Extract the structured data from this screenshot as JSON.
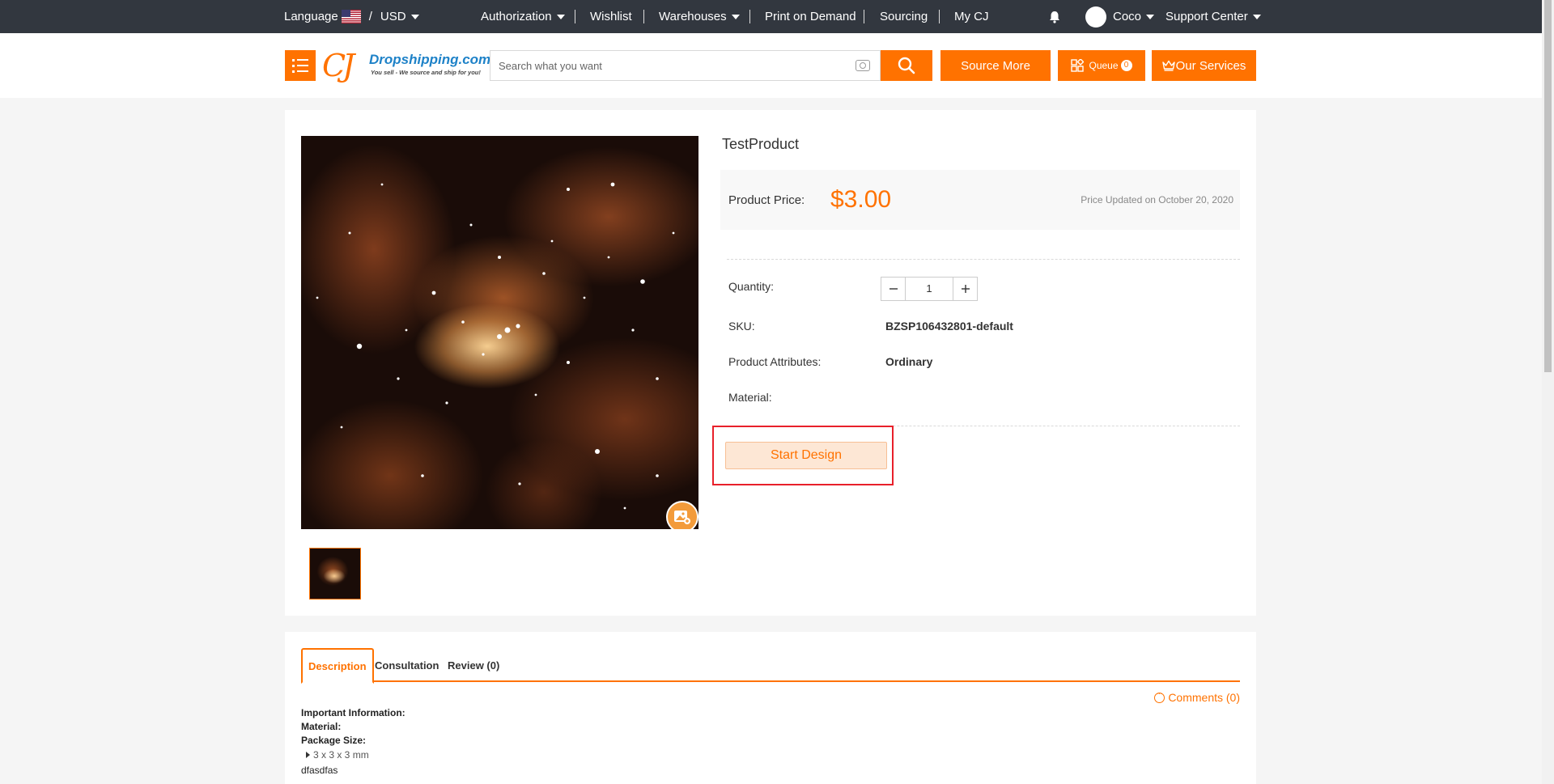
{
  "topbar": {
    "language_label": "Language",
    "slash": "/",
    "currency": "USD",
    "nav": {
      "authorization": "Authorization",
      "wishlist": "Wishlist",
      "warehouses": "Warehouses",
      "print_on_demand": "Print on Demand",
      "sourcing": "Sourcing",
      "my_cj": "My CJ"
    },
    "user_name": "Coco",
    "support": "Support Center",
    "icons": [
      "us-flag-icon",
      "bell-icon",
      "avatar",
      "caret-down-icon"
    ]
  },
  "header": {
    "logo": {
      "mark": "CJ",
      "brand": "Dropshipping.com",
      "tagline": "You sell - We source and ship for you!"
    },
    "search_placeholder": "Search what you want",
    "source_more": "Source More",
    "queue_label": "Queue",
    "queue_count": "0",
    "our_services": "Our Services",
    "icons": [
      "menu-icon",
      "camera-icon",
      "search-icon",
      "queue-icon",
      "crown-icon"
    ],
    "accent": "#ff7200"
  },
  "product": {
    "title": "TestProduct",
    "price_label": "Product Price:",
    "price": "$3.00",
    "price_updated": "Price Updated on October 20, 2020",
    "quantity_label": "Quantity:",
    "quantity": "1",
    "sku_label": "SKU:",
    "sku": "BZSP106432801-default",
    "attributes_label": "Product Attributes:",
    "attributes": "Ordinary",
    "material_label": "Material:",
    "material": "",
    "start_design": "Start Design",
    "image_icon": "image-edit-icon"
  },
  "description": {
    "tabs": [
      "Description",
      "Consultation",
      "Review (0)"
    ],
    "active_tab": "Description",
    "comments": "Comments (0)",
    "lines": {
      "important": "Important Information:",
      "material": "Material:",
      "package_size": "Package Size:",
      "package_value": "3 x 3 x 3 mm",
      "note": "dfasdfas"
    }
  }
}
